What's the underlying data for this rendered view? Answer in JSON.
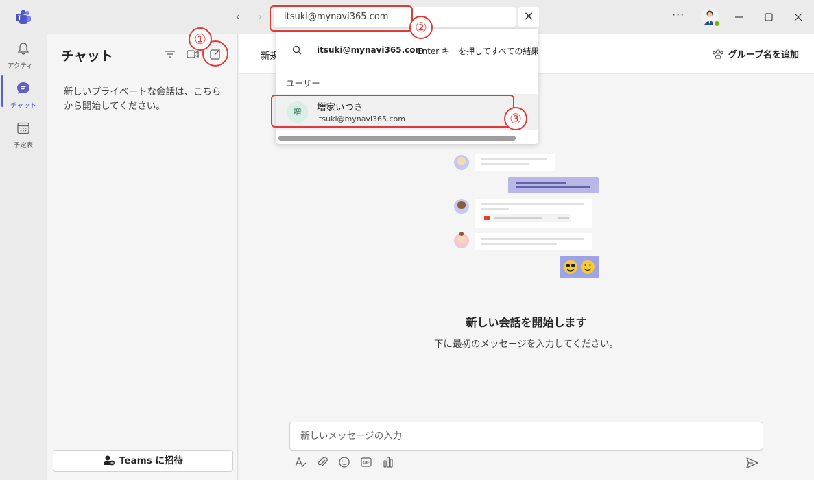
{
  "titlebar": {
    "search_value": "itsuki@mynavi365.com",
    "close_symbol": "✕",
    "more_symbol": "···"
  },
  "rail": {
    "items": [
      {
        "label": "アクティ...",
        "icon": "bell-icon"
      },
      {
        "label": "チャット",
        "icon": "chat-icon"
      },
      {
        "label": "予定表",
        "icon": "calendar-icon"
      }
    ]
  },
  "chat_panel": {
    "title": "チャット",
    "empty_message": "新しいプライベートな会話は、こちらから開始してください。",
    "invite_button": "Teams に招待"
  },
  "main": {
    "header_label": "新規",
    "group_name_button": "グループ名を追加",
    "start_title": "新しい会話を開始します",
    "start_subtitle": "下に最初のメッセージを入力してください。",
    "composer_placeholder": "新しいメッセージの入力"
  },
  "dropdown": {
    "query": "itsuki@mynavi365.com",
    "hint": "Enter キーを押してすべての結果を",
    "section_label": "ユーザー",
    "user": {
      "avatar_char": "増",
      "name": "増家いつき",
      "email": "itsuki@mynavi365.com"
    }
  },
  "annotations": {
    "step1": "①",
    "step2": "②",
    "step3": "③"
  },
  "colors": {
    "accent": "#5b5fc7",
    "annotation_red": "#e53935",
    "presence_green": "#6bb700"
  }
}
